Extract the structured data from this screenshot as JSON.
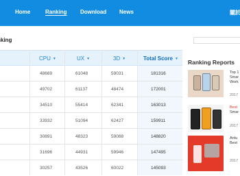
{
  "nav": {
    "items": [
      "Home",
      "Ranking",
      "Download",
      "News"
    ],
    "right_label": "關於"
  },
  "page": {
    "title": "nking"
  },
  "table": {
    "columns": [
      "CPU",
      "UX",
      "3D",
      "Total Score"
    ],
    "rows": [
      [
        "48669",
        "61048",
        "59031",
        "181316"
      ],
      [
        "49702",
        "61137",
        "48474",
        "172001"
      ],
      [
        "34510",
        "55414",
        "62341",
        "163013"
      ],
      [
        "33932",
        "51094",
        "62427",
        "159911"
      ],
      [
        "30891",
        "48323",
        "59088",
        "148820"
      ],
      [
        "31696",
        "44931",
        "59946",
        "147495"
      ],
      [
        "30257",
        "43526",
        "60022",
        "145093"
      ]
    ]
  },
  "sidebar": {
    "title": "Ranking Reports",
    "reports": [
      {
        "line1": "Top 1",
        "line2": "Smar",
        "line3": "Work",
        "date": "2017"
      },
      {
        "line1": "Best",
        "line2": "Smar",
        "line3": "",
        "date": "2017"
      },
      {
        "line1": "Antu",
        "line2": "Best",
        "line3": "",
        "date": "2017"
      }
    ]
  },
  "colors": {
    "nav": "#118ce0",
    "header_bg": "#e5f1fb",
    "header_text": "#1e86d8",
    "accent_red": "#e43a2a"
  }
}
